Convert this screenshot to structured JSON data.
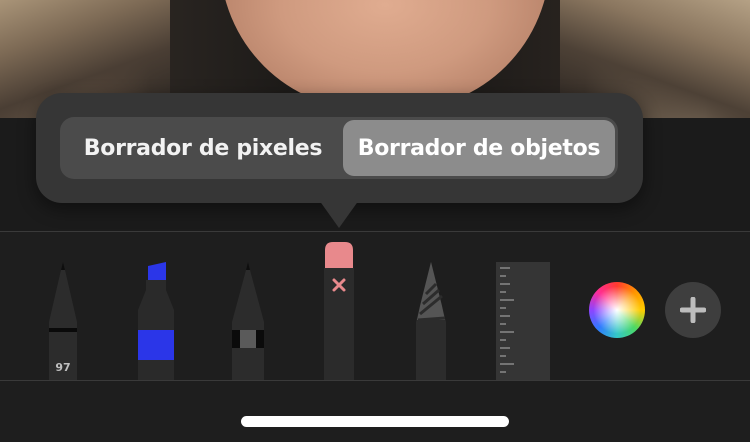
{
  "eraser_popover": {
    "segments": [
      {
        "label": "Borrador de pixeles",
        "selected": false
      },
      {
        "label": "Borrador de objetos",
        "selected": true
      }
    ]
  },
  "toolbar": {
    "tools": [
      {
        "icon": "pen-icon",
        "label": "97"
      },
      {
        "icon": "marker-icon",
        "label": ""
      },
      {
        "icon": "pencil-icon",
        "label": ""
      },
      {
        "icon": "eraser-icon",
        "label": ""
      },
      {
        "icon": "lasso-icon",
        "label": ""
      },
      {
        "icon": "ruler-icon",
        "label": ""
      }
    ],
    "color_picker": {
      "icon": "color-wheel-icon"
    },
    "add_button": {
      "icon": "plus-icon"
    }
  },
  "colors": {
    "marker_accent": "#2b36e8",
    "eraser_cap": "#e8898c",
    "selected_segment": "#8c8c8c"
  }
}
